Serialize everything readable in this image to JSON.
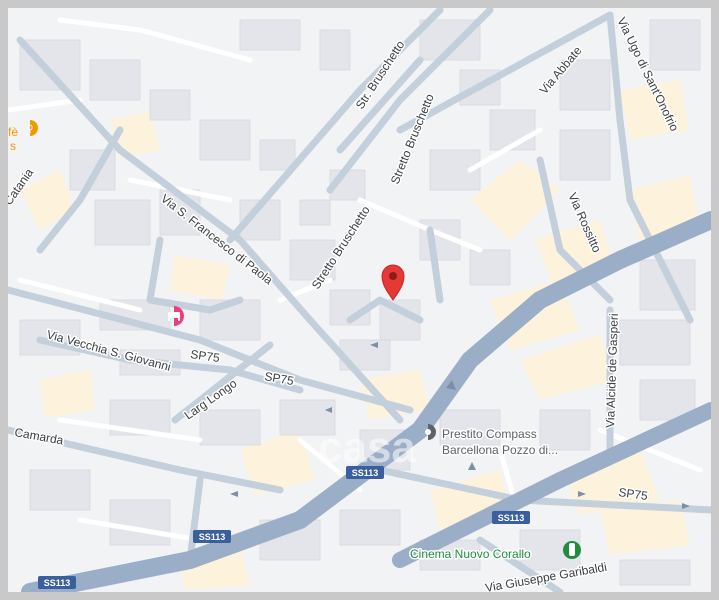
{
  "map": {
    "streets": {
      "str_bruschetto": "Str. Bruschetto",
      "stretto_bruschetto_top": "Stretto Bruschetto",
      "stretto_bruschetto_mid": "Stretto Bruschetto",
      "via_abbate": "Via Abbate",
      "via_ugo": "Via Ugo di Sant'Onofrio",
      "via_francesco": "Via S. Francesco di Paola",
      "via_rossitto": "Via Rossitto",
      "via_vecchia": "Via Vecchia S. Giovanni",
      "larg_longo": "Larg Longo",
      "via_gasperi": "Via Alcide de Gasperi",
      "camarda": "Camarda",
      "via_garibaldi": "Via Giuseppe Garibaldi",
      "catania": "Catania"
    },
    "road_shields": {
      "sp75_a": "SP75",
      "sp75_b": "SP75",
      "sp75_c": "SP75",
      "ss113_a": "SS113",
      "ss113_b": "SS113",
      "ss113_c": "SS113",
      "ss113_d": "SS113"
    },
    "pois": {
      "prestito_line1": "Prestito Compass",
      "prestito_line2": "Barcellona Pozzo di...",
      "cinema": "Cinema Nuovo Corallo",
      "cafe_fragment": "fè",
      "cafe_fragment2": "s"
    },
    "watermark": "casa",
    "colors": {
      "background": "#f2f3f5",
      "building": "#e3e5ea",
      "yellow_block": "#fdf3dc",
      "street": "#ffffff",
      "main_road": "#9aaec7",
      "secondary_road": "#c4cfdc",
      "marker": "#e53935",
      "hotel": "#ec407a",
      "restaurant": "#f29900",
      "transit": "#1e8e3e"
    },
    "icons": {
      "marker": "location-pin-icon",
      "hotel": "hotel-icon",
      "restaurant": "restaurant-icon",
      "place": "place-pin-icon",
      "transit": "traffic-light-icon"
    }
  }
}
